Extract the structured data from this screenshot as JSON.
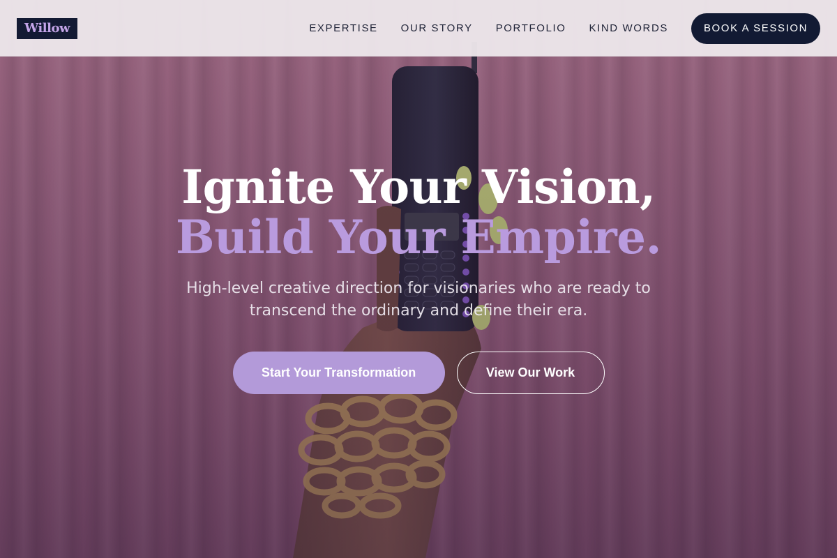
{
  "brand": {
    "logo_text": "Willow"
  },
  "nav": {
    "links": [
      "EXPERTISE",
      "OUR STORY",
      "PORTFOLIO",
      "KIND WORDS"
    ],
    "cta_label": "BOOK A SESSION"
  },
  "hero": {
    "headline_line1": "Ignite Your Vision,",
    "headline_line2": "Build Your Empire.",
    "subtitle": "High-level creative direction for visionaries who are ready to transcend the ordinary and define their era.",
    "primary_cta": "Start Your Transformation",
    "secondary_cta": "View Our Work"
  },
  "colors": {
    "navy": "#121a33",
    "lavender": "#b39ad9",
    "headline_accent": "#b99bde",
    "navbar_bg": "#ece6ea",
    "curtain_pink": "#b87a8f"
  },
  "icons": {
    "hero_image": "hand-holding-retro-phone-image"
  }
}
